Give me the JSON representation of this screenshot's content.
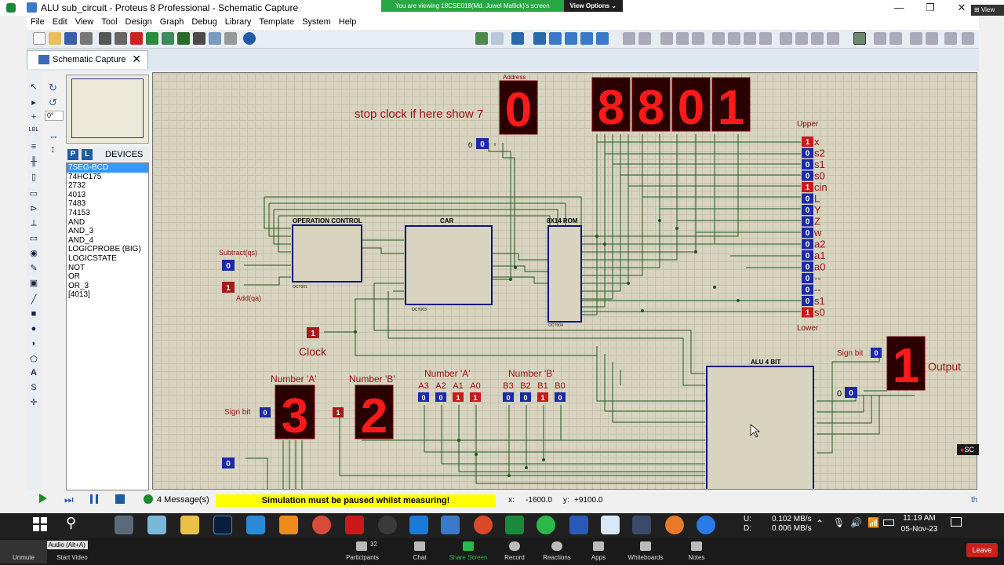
{
  "window": {
    "title": "ALU sub_circuit - Proteus 8 Professional - Schematic Capture",
    "banner": "You are viewing 18CSE018(Md. Juwel Mallick)'s screen",
    "banner_button": "View Options",
    "view_label": "View"
  },
  "menu": [
    "File",
    "Edit",
    "View",
    "Tool",
    "Design",
    "Graph",
    "Debug",
    "Library",
    "Template",
    "System",
    "Help"
  ],
  "tab": {
    "label": "Schematic Capture"
  },
  "rotation": "0°",
  "devices": {
    "header": "DEVICES",
    "p_label": "P",
    "l_label": "L",
    "items": [
      "7SEG-BCD",
      "74HC175",
      "2732",
      "4013",
      "7483",
      "74153",
      "AND",
      "AND_3",
      "AND_4",
      "LOGICPROBE (BIG)",
      "LOGICSTATE",
      "NOT",
      "OR",
      "OR_3",
      "[4013]"
    ],
    "selected": 0
  },
  "schematic": {
    "address_label": "Address",
    "address_digit": "0",
    "stop_note": "stop clock if here show 7",
    "top_display": [
      "8",
      "8",
      "0",
      "1"
    ],
    "upper_label": "Upper",
    "lower_label": "Lower",
    "probe_values": [
      "1",
      "0",
      "0",
      "0",
      "1",
      "0",
      "0",
      "0",
      "0",
      "0",
      "0",
      "0",
      "0",
      "0",
      "0",
      "1"
    ],
    "probe_labels": [
      "x",
      "s2",
      "s1",
      "s0",
      "cin",
      "L",
      "Y",
      "Z",
      "w",
      "a2",
      "a1",
      "a0",
      "--",
      "--",
      "s1",
      "s0"
    ],
    "op_control": "OPERATION CONTROL",
    "car": "CAR",
    "rom": "8X14 ROM",
    "alu": "ALU 4 BIT",
    "subtract_label": "Subtract(qs)",
    "subtract_val": "0",
    "add_label": "Add(qa)",
    "add_val": "1",
    "clock_label": "Clock",
    "clock_val": "1",
    "addr_state": "0",
    "sign_bit_label": "Sign bit",
    "sign_bit_out": "0",
    "output_label": "Output",
    "output_digit": "1",
    "output_state": "0",
    "number_a_label": "Number 'A'",
    "number_b_label": "Number 'B'",
    "number_a_digit": "3",
    "number_b_digit": "2",
    "sign_a_val": "0",
    "sign_b_val": "1",
    "bits_a_label": "Number 'A'",
    "bits_b_label": "Number 'B'",
    "bits_a": [
      "A3",
      "A2",
      "A1",
      "A0"
    ],
    "bits_b": [
      "B3",
      "B2",
      "B1",
      "B0"
    ],
    "bits_a_vals": [
      "0",
      "0",
      "1",
      "1"
    ],
    "bits_b_vals": [
      "0",
      "0",
      "1",
      "0"
    ],
    "bottom_state": "0",
    "ic_ref_op": "OCT001",
    "ic_ref_car": "OCT003",
    "ic_ref_rom": "OCT004",
    "rec": "SC"
  },
  "status": {
    "messages": "4 Message(s)",
    "warning": "Simulation must be paused whilst measuring!",
    "x_label": "x:",
    "x_value": "-1600.0",
    "y_label": "y:",
    "y_value": "+9100.0",
    "th": "th"
  },
  "taskbar": {
    "net_up_label": "U:",
    "net_down_label": "D:",
    "net_up": "0.102 MB/s",
    "net_down": "0.006 MB/s",
    "time": "11:19 AM",
    "date": "05-Nov-23"
  },
  "zoom": {
    "tooltip": "Mute My Audio (Alt+A)",
    "items": [
      {
        "label": "Unmute"
      },
      {
        "label": "Start Video"
      },
      {
        "label": "Participants",
        "count": "32"
      },
      {
        "label": "Chat"
      },
      {
        "label": "Share Screen"
      },
      {
        "label": "Record"
      },
      {
        "label": "Reactions"
      },
      {
        "label": "Apps"
      },
      {
        "label": "Whiteboards"
      },
      {
        "label": "Notes"
      }
    ],
    "leave": "Leave"
  },
  "colors": {
    "accent": "#1f5aa6",
    "seg_on": "#ff1a1a",
    "seg_bg": "#2a0000",
    "wire": "#1c5a1c",
    "ic_fill": "#d8d4c0",
    "ic_border": "#101080"
  }
}
